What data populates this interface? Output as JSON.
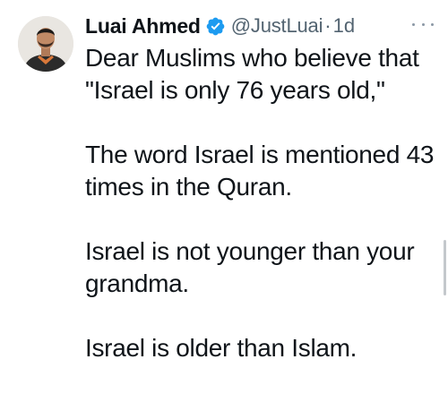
{
  "author": {
    "name": "Luai Ahmed",
    "handle": "@JustLuai",
    "separator": "·",
    "time": "1d",
    "verified": true,
    "avatar_icon": "profile-photo"
  },
  "tweet": {
    "paragraphs": [
      "Dear Muslims who believe that \"Israel is only 76 years old,\"",
      "The word Israel is mentioned 43 times in the Quran.",
      "Israel is not younger than your grandma.",
      "Israel is older than Islam."
    ]
  },
  "colors": {
    "verified_badge": "#1d9bf0",
    "secondary_text": "#536471",
    "primary_text": "#0f1419"
  },
  "icons": {
    "more": "more-horizontal-icon",
    "verified": "verified-badge-icon"
  }
}
